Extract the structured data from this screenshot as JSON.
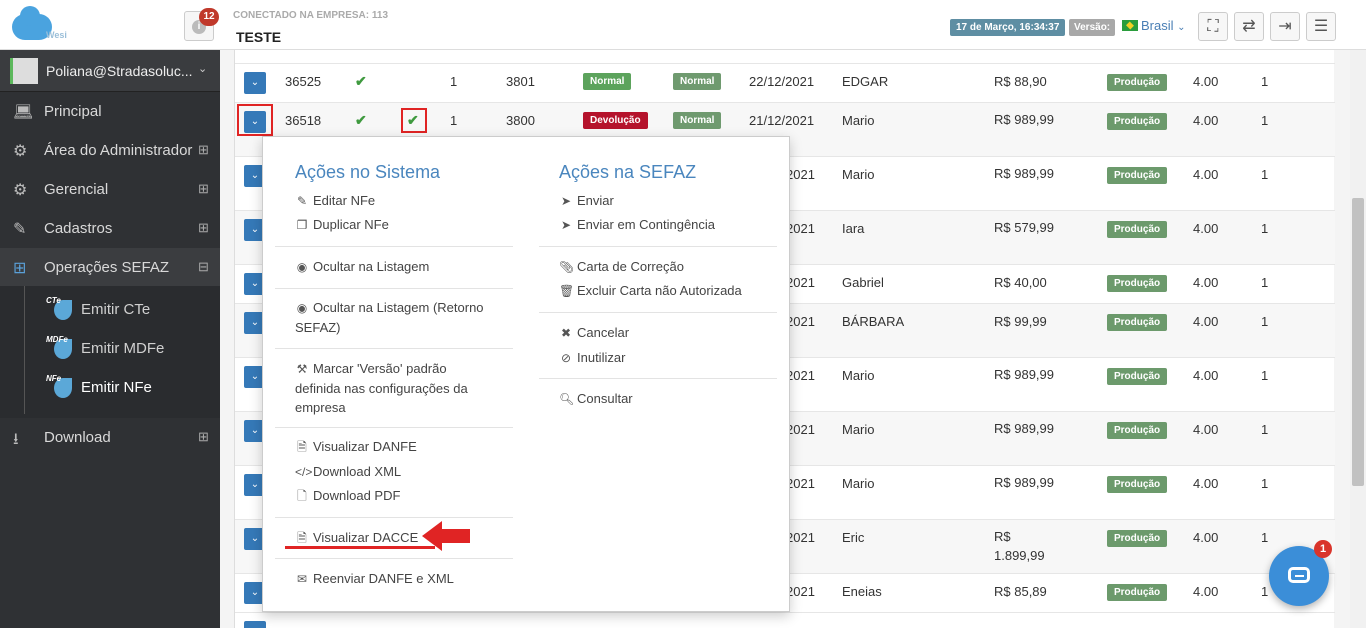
{
  "header": {
    "logo_text": "Wesi",
    "notification_count": "12",
    "company_label": "CONECTADO NA EMPRESA: 113",
    "company_name": "TESTE",
    "date": "17 de Março, 16:34:37",
    "version_label": "Versão:",
    "language": "Brasil"
  },
  "sidebar": {
    "user": "Poliana@Stradasoluc...",
    "items": [
      {
        "label": "Principal",
        "icon": "laptop-icon"
      },
      {
        "label": "Área do Administrador",
        "icon": "gears-icon"
      },
      {
        "label": "Gerencial",
        "icon": "gears-icon"
      },
      {
        "label": "Cadastros",
        "icon": "edit-icon"
      },
      {
        "label": "Operações SEFAZ",
        "icon": "windows-icon"
      },
      {
        "label": "Download",
        "icon": "download-icon"
      }
    ],
    "subitems": [
      {
        "label": "Emitir CTe",
        "tag": "CTe"
      },
      {
        "label": "Emitir MDFe",
        "tag": "MDFe"
      },
      {
        "label": "Emitir NFe",
        "tag": "NFe"
      }
    ]
  },
  "table": {
    "rows": [
      {
        "id": "36525",
        "qty": "1",
        "num": "3801",
        "type": "Normal",
        "status": "Normal",
        "date": "22/12/2021",
        "name": "EDGAR",
        "value": "R$ 88,90",
        "env": "Produção",
        "ver": "4.00",
        "n": "1"
      },
      {
        "id": "36518",
        "qty": "1",
        "num": "3800",
        "type": "Devolução",
        "status": "Normal",
        "date": "21/12/2021",
        "name": "Mario",
        "value": "R$ 989,99",
        "env": "Produção",
        "ver": "4.00",
        "n": "1"
      },
      {
        "date": "2021",
        "name": "Mario",
        "value": "R$ 989,99",
        "env": "Produção",
        "ver": "4.00",
        "n": "1"
      },
      {
        "date": "2021",
        "name": "Iara",
        "value": "R$ 579,99",
        "env": "Produção",
        "ver": "4.00",
        "n": "1"
      },
      {
        "date": "2021",
        "name": "Gabriel",
        "value": "R$ 40,00",
        "env": "Produção",
        "ver": "4.00",
        "n": "1"
      },
      {
        "date": "2021",
        "name": "BÁRBARA",
        "value": "R$ 99,99",
        "env": "Produção",
        "ver": "4.00",
        "n": "1"
      },
      {
        "date": "2021",
        "name": "Mario",
        "value": "R$ 989,99",
        "env": "Produção",
        "ver": "4.00",
        "n": "1"
      },
      {
        "date": "2021",
        "name": "Mario",
        "value": "R$ 989,99",
        "env": "Produção",
        "ver": "4.00",
        "n": "1"
      },
      {
        "date": "2021",
        "name": "Mario",
        "value": "R$ 989,99",
        "env": "Produção",
        "ver": "4.00",
        "n": "1"
      },
      {
        "date": "2021",
        "name": "Eric",
        "value": "R$ 1.899,99",
        "env": "Produção",
        "ver": "4.00",
        "n": "1"
      },
      {
        "date": "2021",
        "name": "Eneias",
        "value": "R$ 85,89",
        "env": "Produção",
        "ver": "4.00",
        "n": "1"
      }
    ]
  },
  "dropdown": {
    "system_title": "Ações no Sistema",
    "sefaz_title": "Ações na SEFAZ",
    "system_items": [
      {
        "label": "Editar NFe",
        "icon": "pencil-icon"
      },
      {
        "label": "Duplicar NFe",
        "icon": "copy-icon"
      },
      {
        "label": "Ocultar na Listagem",
        "icon": "eye-slash-icon"
      },
      {
        "label": "Ocultar na Listagem (Retorno SEFAZ)",
        "icon": "eye-slash-icon"
      },
      {
        "label": "Marcar 'Versão' padrão definida nas configurações da empresa",
        "icon": "wrench-icon"
      },
      {
        "label": "Visualizar DANFE",
        "icon": "file-icon"
      },
      {
        "label": "Download XML",
        "icon": "code-icon"
      },
      {
        "label": "Download PDF",
        "icon": "pdf-icon"
      },
      {
        "label": "Visualizar DACCE",
        "icon": "file-icon"
      },
      {
        "label": "Reenviar DANFE e XML",
        "icon": "envelope-icon"
      }
    ],
    "sefaz_items": [
      {
        "label": "Enviar",
        "icon": "send-icon"
      },
      {
        "label": "Enviar em Contingência",
        "icon": "send-filled-icon"
      },
      {
        "label": "Carta de Correção",
        "icon": "paperclip-icon"
      },
      {
        "label": "Excluir Carta não Autorizada",
        "icon": "trash-icon"
      },
      {
        "label": "Cancelar",
        "icon": "times-icon"
      },
      {
        "label": "Inutilizar",
        "icon": "ban-icon"
      },
      {
        "label": "Consultar",
        "icon": "search-icon"
      }
    ]
  },
  "chat": {
    "badge": "1"
  },
  "colors": {
    "accent": "#3579b8",
    "highlight": "#e02424",
    "sidebar": "#2f3134"
  }
}
